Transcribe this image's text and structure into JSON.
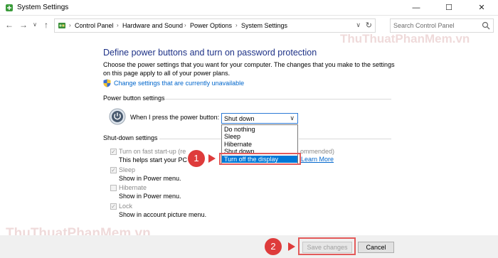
{
  "window": {
    "title": "System Settings",
    "minimize": "—",
    "maximize": "☐",
    "close": "✕"
  },
  "nav": {
    "back": "←",
    "forward": "→",
    "recent": "∨",
    "up": "↑",
    "breadcrumbs": [
      "Control Panel",
      "Hardware and Sound",
      "Power Options",
      "System Settings"
    ],
    "separator": "›",
    "dropdown": "∨",
    "refresh": "↻",
    "search_placeholder": "Search Control Panel"
  },
  "page": {
    "heading": "Define power buttons and turn on password protection",
    "description": "Choose the power settings that you want for your computer. The changes that you make to the settings on this page apply to all of your power plans.",
    "change_link": "Change settings that are currently unavailable"
  },
  "power_button": {
    "section_title": "Power button settings",
    "label": "When I press the power button:",
    "selected": "Shut down",
    "arrow": "∨",
    "options": [
      "Do nothing",
      "Sleep",
      "Hibernate",
      "Shut down",
      "Turn off the display"
    ],
    "highlighted_option": "Turn off the display"
  },
  "shutdown": {
    "section_title": "Shut-down settings",
    "items": [
      {
        "title": "Turn on fast start-up (re",
        "title_tail": "ommended)",
        "desc": "This helps start your PC",
        "checked": true
      },
      {
        "title": "Sleep",
        "desc": "Show in Power menu.",
        "checked": true
      },
      {
        "title": "Hibernate",
        "desc": "Show in Power menu.",
        "checked": false
      },
      {
        "title": "Lock",
        "desc": "Show in account picture menu.",
        "checked": true
      }
    ],
    "check_glyph": "✓",
    "learn_more": "Learn More"
  },
  "buttons": {
    "save": "Save changes",
    "cancel": "Cancel"
  },
  "callouts": {
    "one": "1",
    "two": "2"
  },
  "watermark": "ThuThuatPhanMem.vn",
  "colors": {
    "heading": "#1e3287",
    "link": "#0066cc",
    "selection": "#0078d7",
    "callout": "#de3b3b"
  }
}
